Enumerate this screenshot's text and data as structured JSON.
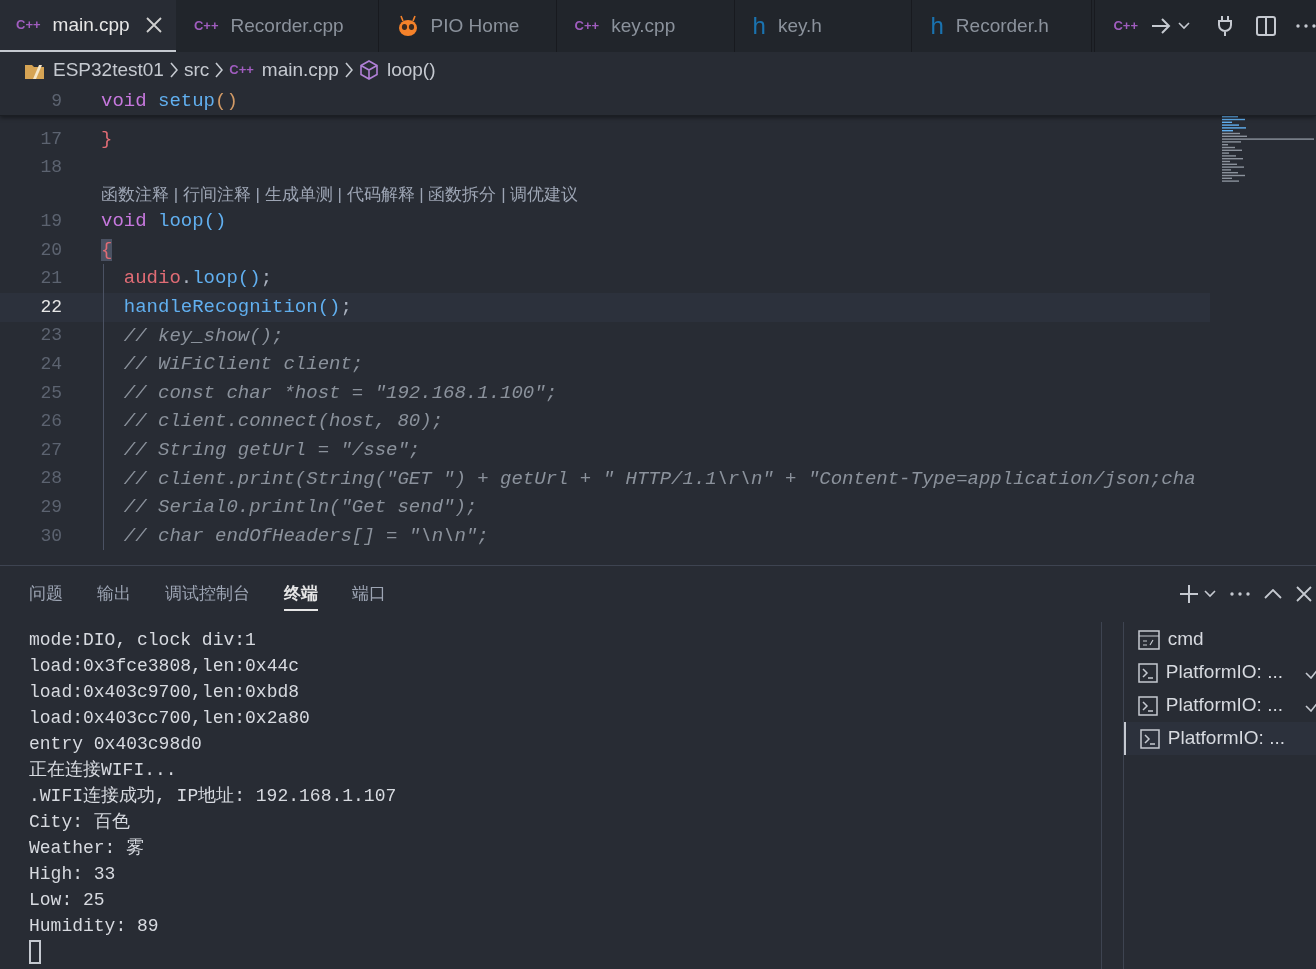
{
  "tabs": [
    {
      "label": "main.cpp",
      "kind": "cpp",
      "icon": "C++",
      "selected": true
    },
    {
      "label": "Recorder.cpp",
      "kind": "cpp",
      "icon": "C++",
      "selected": false
    },
    {
      "label": "PIO Home",
      "kind": "pio",
      "selected": false
    },
    {
      "label": "key.cpp",
      "kind": "cpp",
      "icon": "C++",
      "selected": false
    },
    {
      "label": "key.h",
      "kind": "header",
      "icon": "h",
      "selected": false
    },
    {
      "label": "Recorder.h",
      "kind": "header",
      "icon": "h",
      "selected": false
    }
  ],
  "editor_actions": {
    "language_icon": "C++"
  },
  "breadcrumb": [
    {
      "kind": "folder",
      "label": "ESP32test01"
    },
    {
      "kind": "plain",
      "label": "src"
    },
    {
      "kind": "file",
      "icon": "C++",
      "label": "main.cpp"
    },
    {
      "kind": "symbol",
      "label": "loop()"
    }
  ],
  "sticky_line": {
    "number": "9",
    "tokens": [
      {
        "text": "void ",
        "kind": "keyword"
      },
      {
        "text": "setup",
        "kind": "function"
      },
      {
        "text": "()",
        "kind": "bracket"
      }
    ]
  },
  "code_lines": [
    {
      "number": "17",
      "current": false,
      "tokens": [
        {
          "text": "}",
          "kind": "bracket2"
        }
      ]
    },
    {
      "number": "18",
      "current": false
    },
    {
      "codelens": "函数注释 | 行间注释 | 生成单测 | 代码解释 | 函数拆分 | 调优建议"
    },
    {
      "number": "19",
      "current": false,
      "tokens": [
        {
          "text": "void ",
          "kind": "keyword"
        },
        {
          "text": "loop",
          "kind": "function"
        },
        {
          "text": "()",
          "kind": "bracket3"
        }
      ]
    },
    {
      "number": "20",
      "current": false,
      "tokens": [
        {
          "text": "{",
          "kind": "bracket-match"
        }
      ]
    },
    {
      "number": "21",
      "current": false,
      "indented": true,
      "tokens": [
        {
          "text": "audio",
          "kind": "variable"
        },
        {
          "text": ".",
          "kind": "punct"
        },
        {
          "text": "loop",
          "kind": "function"
        },
        {
          "text": "()",
          "kind": "bracket3"
        },
        {
          "text": ";",
          "kind": "punct"
        }
      ]
    },
    {
      "number": "22",
      "current": true,
      "indented": true,
      "tokens": [
        {
          "text": "handleRecognition",
          "kind": "function"
        },
        {
          "text": "()",
          "kind": "bracket3"
        },
        {
          "text": ";",
          "kind": "punct"
        }
      ]
    },
    {
      "number": "23",
      "current": false,
      "indented": true,
      "tokens": [
        {
          "text": "// key_show();",
          "kind": "comment"
        }
      ]
    },
    {
      "number": "24",
      "current": false,
      "indented": true,
      "tokens": [
        {
          "text": "// WiFiClient client;",
          "kind": "comment"
        }
      ]
    },
    {
      "number": "25",
      "current": false,
      "indented": true,
      "tokens": [
        {
          "text": "// const char *host = \"192.168.1.100\";",
          "kind": "comment"
        }
      ]
    },
    {
      "number": "26",
      "current": false,
      "indented": true,
      "tokens": [
        {
          "text": "// client.connect(host, 80);",
          "kind": "comment"
        }
      ]
    },
    {
      "number": "27",
      "current": false,
      "indented": true,
      "tokens": [
        {
          "text": "// String getUrl = \"/sse\";",
          "kind": "comment"
        }
      ]
    },
    {
      "number": "28",
      "current": false,
      "indented": true,
      "tokens": [
        {
          "text": "// client.print(String(\"GET \") + getUrl + \" HTTP/1.1\\r\\n\" + \"Content-Type=application/json;cha",
          "kind": "comment"
        }
      ]
    },
    {
      "number": "29",
      "current": false,
      "indented": true,
      "tokens": [
        {
          "text": "// Serial0.println(\"Get send\");",
          "kind": "comment"
        }
      ]
    },
    {
      "number": "30",
      "current": false,
      "indented": true,
      "tokens": [
        {
          "text": "// char endOfHeaders[] = \"\\n\\n\";",
          "kind": "comment"
        }
      ]
    }
  ],
  "panel_tabs": [
    {
      "label": "问题",
      "selected": false
    },
    {
      "label": "输出",
      "selected": false
    },
    {
      "label": "调试控制台",
      "selected": false
    },
    {
      "label": "终端",
      "selected": true
    },
    {
      "label": "端口",
      "selected": false
    }
  ],
  "terminal_output": [
    "mode:DIO, clock div:1",
    "load:0x3fce3808,len:0x44c",
    "load:0x403c9700,len:0xbd8",
    "load:0x403cc700,len:0x2a80",
    "entry 0x403c98d0",
    "正在连接WIFI...",
    ".WIFI连接成功, IP地址: 192.168.1.107",
    "City: 百色",
    "Weather: 雾",
    "High: 33",
    "Low: 25",
    "Humidity: 89"
  ],
  "terminals": [
    {
      "label": "cmd",
      "kind": "cmd",
      "selected": false,
      "completed": false
    },
    {
      "label": "PlatformIO: ...",
      "kind": "shell",
      "selected": false,
      "completed": true
    },
    {
      "label": "PlatformIO: ...",
      "kind": "shell",
      "selected": false,
      "completed": true
    },
    {
      "label": "PlatformIO: ...",
      "kind": "shell",
      "selected": true,
      "completed": false
    }
  ]
}
